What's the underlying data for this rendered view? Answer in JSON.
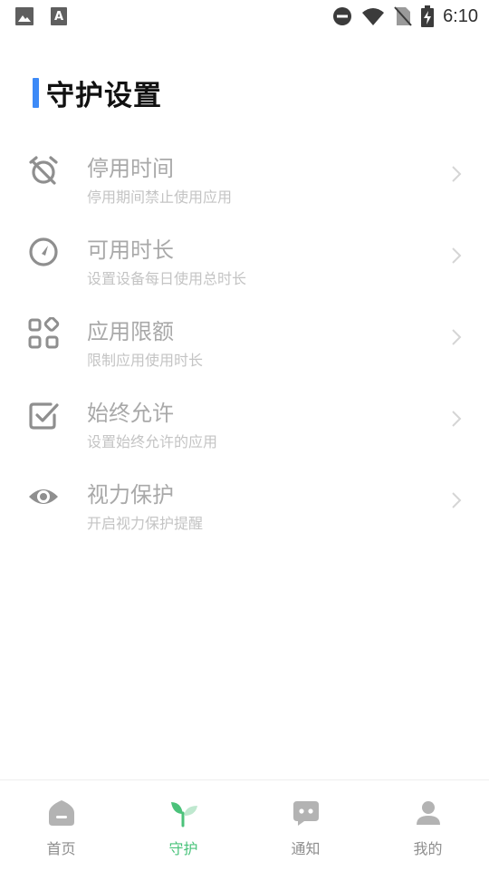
{
  "status_bar": {
    "time": "6:10",
    "icons": [
      "image-icon",
      "font-a-icon",
      "do-not-disturb-icon",
      "wifi-icon",
      "no-sim-icon",
      "battery-charging-icon"
    ]
  },
  "page": {
    "title": "守护设置",
    "accent_color": "#3d8af7"
  },
  "settings": [
    {
      "title": "停用时间",
      "subtitle": "停用期间禁止使用应用",
      "icon": "alarm-off-icon"
    },
    {
      "title": "可用时长",
      "subtitle": "设置设备每日使用总时长",
      "icon": "gauge-icon"
    },
    {
      "title": "应用限额",
      "subtitle": "限制应用使用时长",
      "icon": "apps-grid-icon"
    },
    {
      "title": "始终允许",
      "subtitle": "设置始终允许的应用",
      "icon": "checkbox-icon"
    },
    {
      "title": "视力保护",
      "subtitle": "开启视力保护提醒",
      "icon": "eye-icon"
    }
  ],
  "bottom_nav": {
    "items": [
      {
        "label": "首页",
        "icon": "home-icon"
      },
      {
        "label": "守护",
        "icon": "sprout-icon",
        "active": true
      },
      {
        "label": "通知",
        "icon": "chat-icon"
      },
      {
        "label": "我的",
        "icon": "person-icon"
      }
    ],
    "active_color": "#48c37a"
  }
}
